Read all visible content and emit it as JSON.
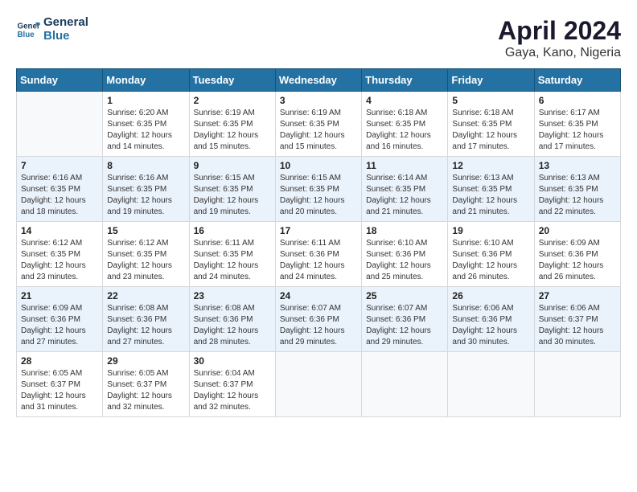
{
  "header": {
    "logo_line1": "General",
    "logo_line2": "Blue",
    "title": "April 2024",
    "subtitle": "Gaya, Kano, Nigeria"
  },
  "columns": [
    "Sunday",
    "Monday",
    "Tuesday",
    "Wednesday",
    "Thursday",
    "Friday",
    "Saturday"
  ],
  "weeks": [
    [
      {
        "num": "",
        "info": ""
      },
      {
        "num": "1",
        "info": "Sunrise: 6:20 AM\nSunset: 6:35 PM\nDaylight: 12 hours\nand 14 minutes."
      },
      {
        "num": "2",
        "info": "Sunrise: 6:19 AM\nSunset: 6:35 PM\nDaylight: 12 hours\nand 15 minutes."
      },
      {
        "num": "3",
        "info": "Sunrise: 6:19 AM\nSunset: 6:35 PM\nDaylight: 12 hours\nand 15 minutes."
      },
      {
        "num": "4",
        "info": "Sunrise: 6:18 AM\nSunset: 6:35 PM\nDaylight: 12 hours\nand 16 minutes."
      },
      {
        "num": "5",
        "info": "Sunrise: 6:18 AM\nSunset: 6:35 PM\nDaylight: 12 hours\nand 17 minutes."
      },
      {
        "num": "6",
        "info": "Sunrise: 6:17 AM\nSunset: 6:35 PM\nDaylight: 12 hours\nand 17 minutes."
      }
    ],
    [
      {
        "num": "7",
        "info": "Sunrise: 6:16 AM\nSunset: 6:35 PM\nDaylight: 12 hours\nand 18 minutes."
      },
      {
        "num": "8",
        "info": "Sunrise: 6:16 AM\nSunset: 6:35 PM\nDaylight: 12 hours\nand 19 minutes."
      },
      {
        "num": "9",
        "info": "Sunrise: 6:15 AM\nSunset: 6:35 PM\nDaylight: 12 hours\nand 19 minutes."
      },
      {
        "num": "10",
        "info": "Sunrise: 6:15 AM\nSunset: 6:35 PM\nDaylight: 12 hours\nand 20 minutes."
      },
      {
        "num": "11",
        "info": "Sunrise: 6:14 AM\nSunset: 6:35 PM\nDaylight: 12 hours\nand 21 minutes."
      },
      {
        "num": "12",
        "info": "Sunrise: 6:13 AM\nSunset: 6:35 PM\nDaylight: 12 hours\nand 21 minutes."
      },
      {
        "num": "13",
        "info": "Sunrise: 6:13 AM\nSunset: 6:35 PM\nDaylight: 12 hours\nand 22 minutes."
      }
    ],
    [
      {
        "num": "14",
        "info": "Sunrise: 6:12 AM\nSunset: 6:35 PM\nDaylight: 12 hours\nand 23 minutes."
      },
      {
        "num": "15",
        "info": "Sunrise: 6:12 AM\nSunset: 6:35 PM\nDaylight: 12 hours\nand 23 minutes."
      },
      {
        "num": "16",
        "info": "Sunrise: 6:11 AM\nSunset: 6:35 PM\nDaylight: 12 hours\nand 24 minutes."
      },
      {
        "num": "17",
        "info": "Sunrise: 6:11 AM\nSunset: 6:36 PM\nDaylight: 12 hours\nand 24 minutes."
      },
      {
        "num": "18",
        "info": "Sunrise: 6:10 AM\nSunset: 6:36 PM\nDaylight: 12 hours\nand 25 minutes."
      },
      {
        "num": "19",
        "info": "Sunrise: 6:10 AM\nSunset: 6:36 PM\nDaylight: 12 hours\nand 26 minutes."
      },
      {
        "num": "20",
        "info": "Sunrise: 6:09 AM\nSunset: 6:36 PM\nDaylight: 12 hours\nand 26 minutes."
      }
    ],
    [
      {
        "num": "21",
        "info": "Sunrise: 6:09 AM\nSunset: 6:36 PM\nDaylight: 12 hours\nand 27 minutes."
      },
      {
        "num": "22",
        "info": "Sunrise: 6:08 AM\nSunset: 6:36 PM\nDaylight: 12 hours\nand 27 minutes."
      },
      {
        "num": "23",
        "info": "Sunrise: 6:08 AM\nSunset: 6:36 PM\nDaylight: 12 hours\nand 28 minutes."
      },
      {
        "num": "24",
        "info": "Sunrise: 6:07 AM\nSunset: 6:36 PM\nDaylight: 12 hours\nand 29 minutes."
      },
      {
        "num": "25",
        "info": "Sunrise: 6:07 AM\nSunset: 6:36 PM\nDaylight: 12 hours\nand 29 minutes."
      },
      {
        "num": "26",
        "info": "Sunrise: 6:06 AM\nSunset: 6:36 PM\nDaylight: 12 hours\nand 30 minutes."
      },
      {
        "num": "27",
        "info": "Sunrise: 6:06 AM\nSunset: 6:37 PM\nDaylight: 12 hours\nand 30 minutes."
      }
    ],
    [
      {
        "num": "28",
        "info": "Sunrise: 6:05 AM\nSunset: 6:37 PM\nDaylight: 12 hours\nand 31 minutes."
      },
      {
        "num": "29",
        "info": "Sunrise: 6:05 AM\nSunset: 6:37 PM\nDaylight: 12 hours\nand 32 minutes."
      },
      {
        "num": "30",
        "info": "Sunrise: 6:04 AM\nSunset: 6:37 PM\nDaylight: 12 hours\nand 32 minutes."
      },
      {
        "num": "",
        "info": ""
      },
      {
        "num": "",
        "info": ""
      },
      {
        "num": "",
        "info": ""
      },
      {
        "num": "",
        "info": ""
      }
    ]
  ]
}
